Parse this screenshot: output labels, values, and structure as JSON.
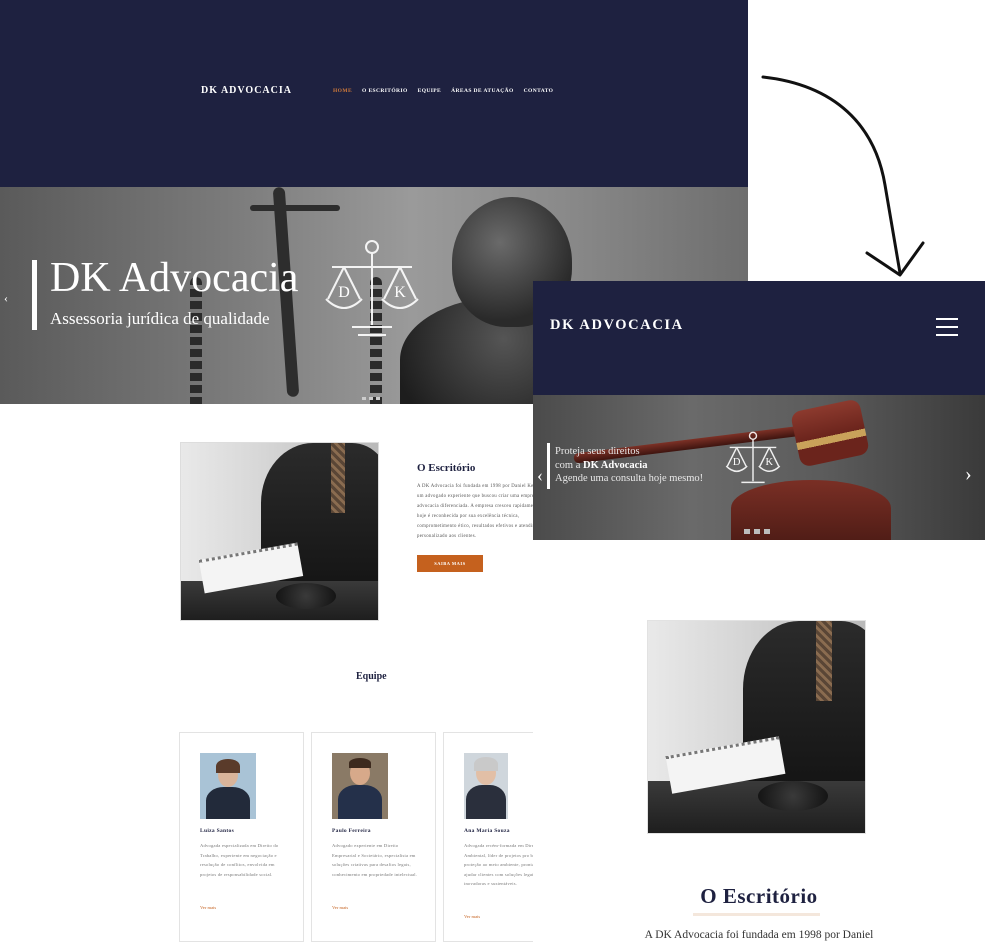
{
  "desktop": {
    "logo": "DK ADVOCACIA",
    "nav": [
      "HOME",
      "O ESCRITÓRIO",
      "EQUIPE",
      "ÁREAS DE ATUAÇÃO",
      "CONTATO"
    ],
    "hero": {
      "title": "DK Advocacia",
      "subtitle": "Assessoria jurídica de qualidade",
      "prev": "‹"
    },
    "office": {
      "title": "O Escritório",
      "text": "A DK Advocacia foi fundada em 1998 por Daniel Keithan, um advogado experiente que buscou criar uma empresa de advocacia diferenciada. A empresa cresceu rapidamente e hoje é reconhecida por sua excelência técnica, comprometimento ético, resultados efetivos e atendimento personalizado aos clientes.",
      "button": "SAIBA MAIS"
    },
    "team": {
      "title": "Equipe",
      "members": [
        {
          "name": "Luiza Santos",
          "bio": "Advogada especializada em Direito do Trabalho, experiente em negociação e resolução de conflitos, envolvida em projetos de responsabilidade social.",
          "more": "Ver mais"
        },
        {
          "name": "Paulo Ferreira",
          "bio": "Advogado experiente em Direito Empresarial e Societário, especialista em soluções criativas para desafios legais, conhecimento em propriedade intelectual.",
          "more": "Ver mais"
        },
        {
          "name": "Ana Maria Souza",
          "bio": "Advogada recém-formada em Direito Ambiental, líder de projetos pro bono de proteção ao meio ambiente, pronta para ajudar clientes com soluções legais inovadoras e sustentáveis.",
          "more": "Ver mais"
        }
      ]
    }
  },
  "mobile": {
    "logo": "DK ADVOCACIA",
    "hero": {
      "line1": "Proteja seus direitos",
      "line2_prefix": "com a ",
      "line2_brand": "DK Advocacia",
      "line3": "Agende uma consulta hoje mesmo!",
      "prev": "‹",
      "next": "›"
    },
    "office": {
      "title": "O Escritório",
      "text": "A DK Advocacia foi fundada em 1998 por Daniel"
    }
  },
  "emblem_letters": [
    "D",
    "K"
  ],
  "colors": {
    "navy": "#1e2140",
    "accent": "#c5611e",
    "nav_active": "#d07a3a"
  }
}
